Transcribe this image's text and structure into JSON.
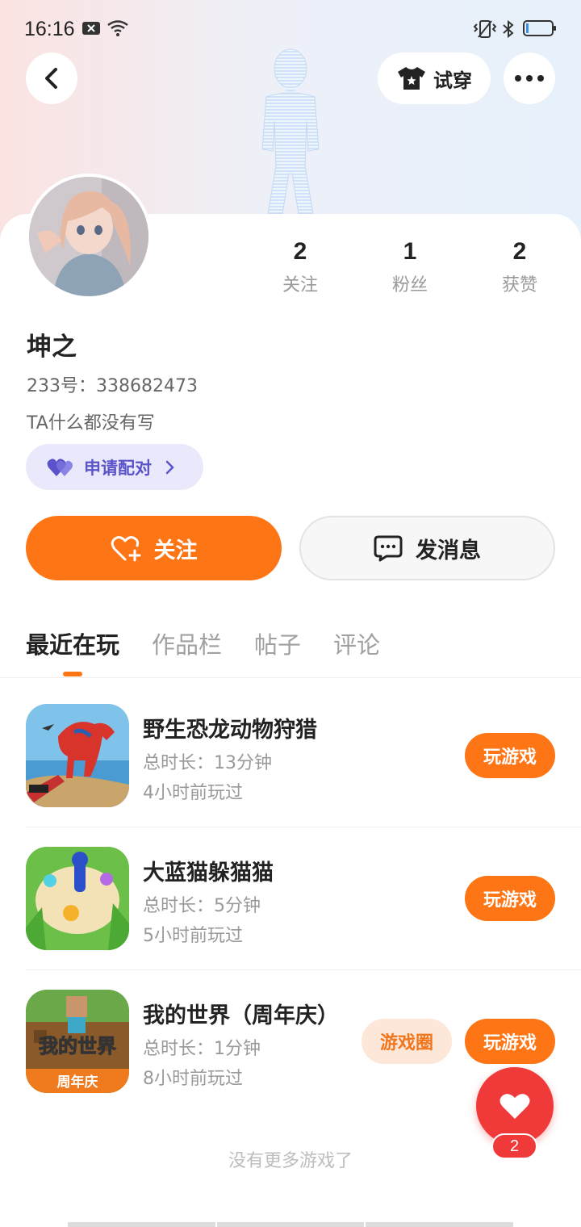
{
  "status_bar": {
    "time": "16:16",
    "icons": [
      "notification-x-icon",
      "wifi-icon",
      "vibrate-icon",
      "bluetooth-icon",
      "battery-icon"
    ]
  },
  "header": {
    "back_icon": "back-arrow-icon",
    "try_on_label": "试穿",
    "more_icon": "more-icon"
  },
  "profile": {
    "name": "坤之",
    "id_text": "233号：338682473",
    "bio": "TA什么都没有写",
    "pair_label": "申请配对",
    "stats": [
      {
        "value": "2",
        "label": "关注"
      },
      {
        "value": "1",
        "label": "粉丝"
      },
      {
        "value": "2",
        "label": "获赞"
      }
    ]
  },
  "actions": {
    "follow_label": "关注",
    "message_label": "发消息"
  },
  "tabs": [
    {
      "label": "最近在玩",
      "active": true
    },
    {
      "label": "作品栏",
      "active": false
    },
    {
      "label": "帖子",
      "active": false
    },
    {
      "label": "评论",
      "active": false
    }
  ],
  "games": [
    {
      "title": "野生恐龙动物狩猎",
      "duration": "总时长：13分钟",
      "last_played": "4小时前玩过",
      "play_label": "玩游戏"
    },
    {
      "title": "大蓝猫躲猫猫",
      "duration": "总时长：5分钟",
      "last_played": "5小时前玩过",
      "play_label": "玩游戏"
    },
    {
      "title": "我的世界（周年庆）",
      "duration": "总时长：1分钟",
      "last_played": "8小时前玩过",
      "play_label": "玩游戏",
      "circle_label": "游戏圈"
    }
  ],
  "game3_icon_text": {
    "line1": "我的世界",
    "line2": "周年庆"
  },
  "footer_text": "没有更多游戏了",
  "fab": {
    "icon": "heart-icon",
    "badge": "2"
  },
  "colors": {
    "accent": "#fd7514",
    "pair": "#5b53c9",
    "fab": "#f03a3a"
  }
}
